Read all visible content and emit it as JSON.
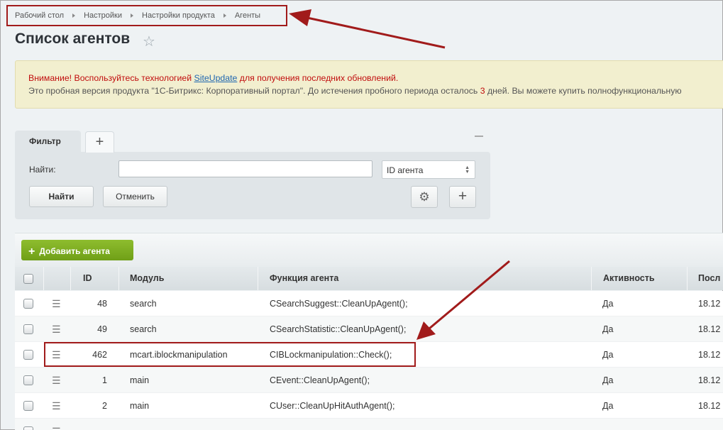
{
  "breadcrumb": {
    "items": [
      "Рабочий стол",
      "Настройки",
      "Настройки продукта",
      "Агенты"
    ]
  },
  "page": {
    "title": "Список агентов"
  },
  "notice": {
    "line1_a": "Внимание! Воспользуйтесь технологией ",
    "line1_link": "SiteUpdate",
    "line1_b": " для получения последних обновлений.",
    "line2_a": "Это пробная версия продукта \"1С-Битрикс: Корпоративный портал\". До истечения пробного периода осталось ",
    "line2_days": "3",
    "line2_b": " дней. Вы можете купить полнофункциональную"
  },
  "filter": {
    "tab_label": "Фильтр",
    "add_tab": "+",
    "find_label": "Найти:",
    "find_value": "",
    "field_select": "ID агента",
    "find_button": "Найти",
    "cancel_button": "Отменить",
    "add_field": "+"
  },
  "toolbar": {
    "add_agent": "Добавить агента"
  },
  "table": {
    "columns": [
      "ID",
      "Модуль",
      "Функция агента",
      "Активность",
      "Посл"
    ],
    "rows": [
      {
        "id": "48",
        "module": "search",
        "function": "CSearchSuggest::CleanUpAgent();",
        "active": "Да",
        "last": "18.12"
      },
      {
        "id": "49",
        "module": "search",
        "function": "CSearchStatistic::CleanUpAgent();",
        "active": "Да",
        "last": "18.12"
      },
      {
        "id": "462",
        "module": "mcart.iblockmanipulation",
        "function": "CIBLockmanipulation::Check();",
        "active": "Да",
        "last": "18.12"
      },
      {
        "id": "1",
        "module": "main",
        "function": "CEvent::CleanUpAgent();",
        "active": "Да",
        "last": "18.12"
      },
      {
        "id": "2",
        "module": "main",
        "function": "CUser::CleanUpHitAuthAgent();",
        "active": "Да",
        "last": "18.12"
      },
      {
        "id": "",
        "module": "",
        "function": "",
        "active": "",
        "last": ""
      }
    ]
  },
  "colors": {
    "accent_green": "#7aab1f",
    "annotation_red": "#a11b1b",
    "notice_red": "#c10d0d"
  },
  "icons": {
    "favorite": "star-icon",
    "settings": "gear-icon",
    "row_menu": "menu-icon"
  }
}
